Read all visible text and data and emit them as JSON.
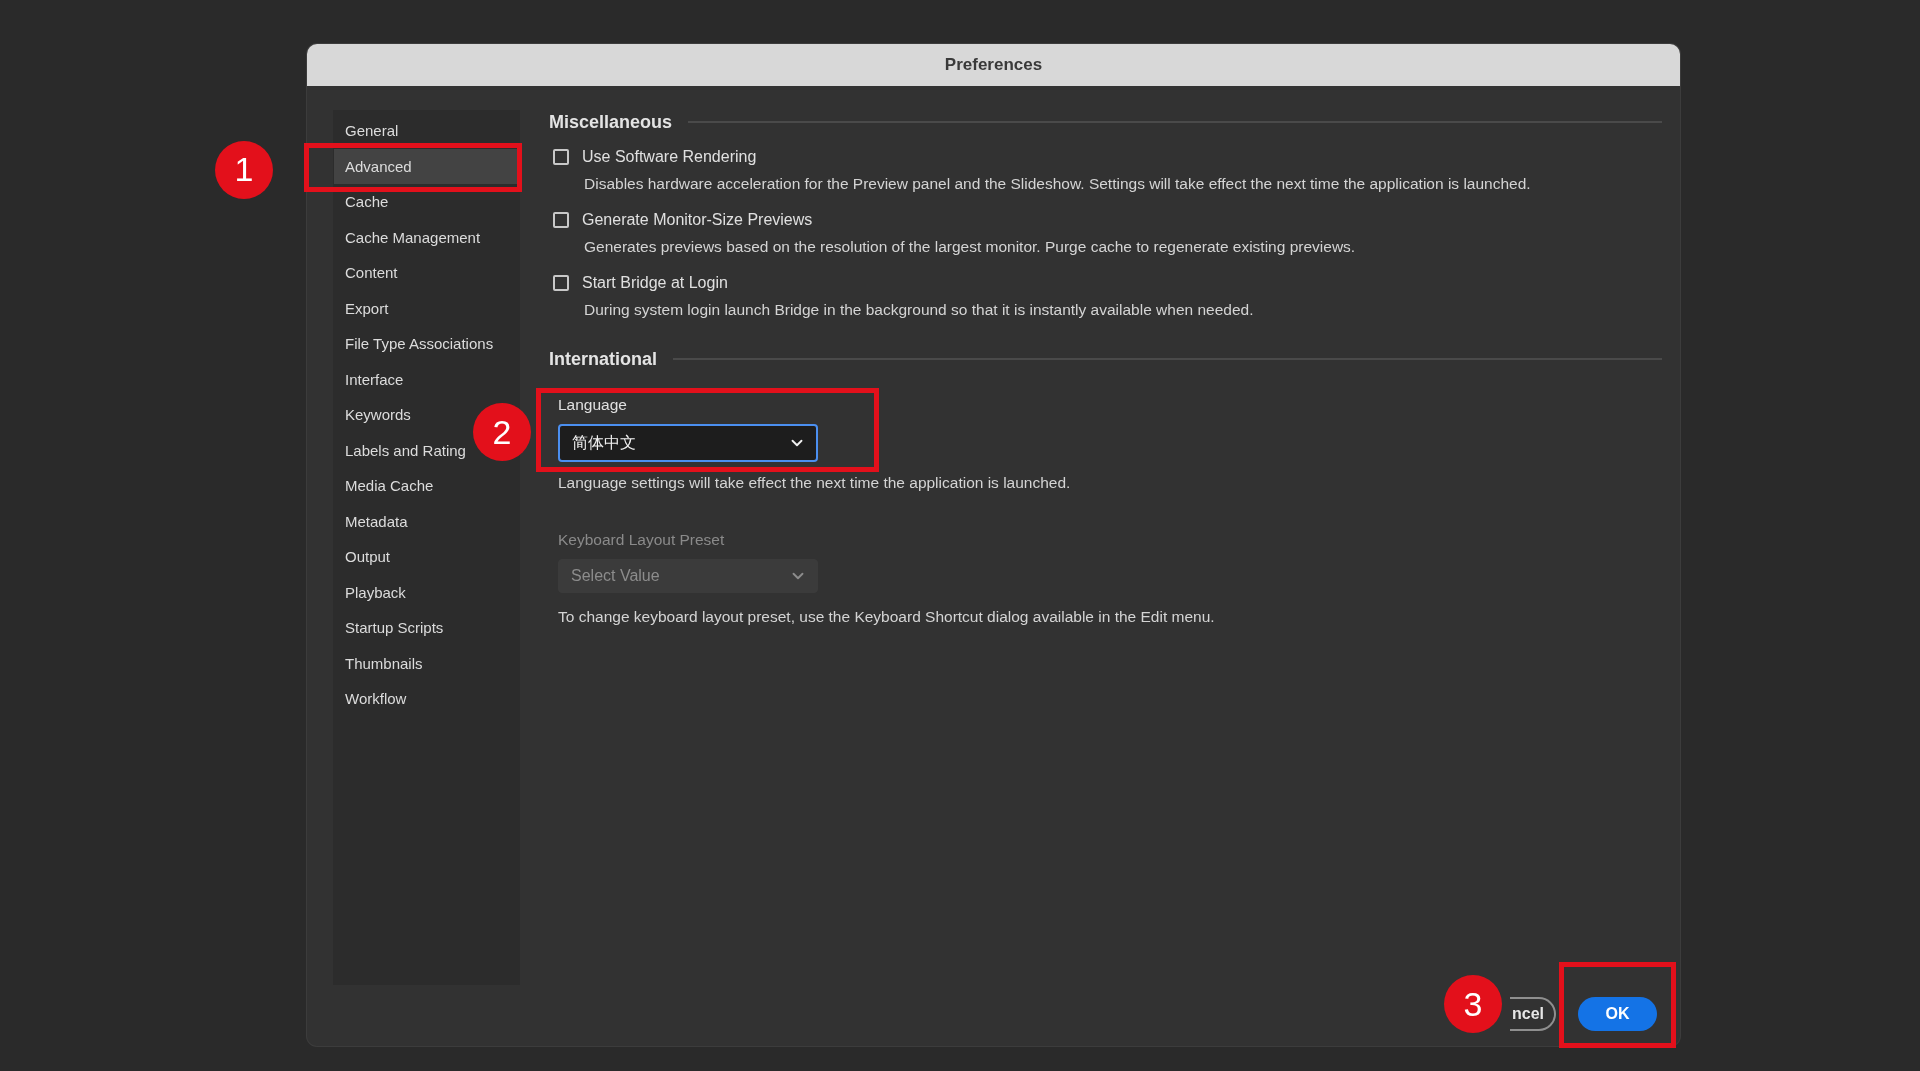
{
  "window": {
    "title": "Preferences"
  },
  "sidebar": {
    "items": [
      {
        "label": "General",
        "selected": false
      },
      {
        "label": "Advanced",
        "selected": true,
        "callout": "1"
      },
      {
        "label": "Cache",
        "selected": false
      },
      {
        "label": "Cache Management",
        "selected": false
      },
      {
        "label": "Content",
        "selected": false
      },
      {
        "label": "Export",
        "selected": false
      },
      {
        "label": "File Type Associations",
        "selected": false
      },
      {
        "label": "Interface",
        "selected": false
      },
      {
        "label": "Keywords",
        "selected": false
      },
      {
        "label": "Labels and Rating",
        "selected": false
      },
      {
        "label": "Media Cache",
        "selected": false
      },
      {
        "label": "Metadata",
        "selected": false
      },
      {
        "label": "Output",
        "selected": false
      },
      {
        "label": "Playback",
        "selected": false
      },
      {
        "label": "Startup Scripts",
        "selected": false
      },
      {
        "label": "Thumbnails",
        "selected": false
      },
      {
        "label": "Workflow",
        "selected": false
      }
    ]
  },
  "miscellaneous": {
    "title": "Miscellaneous",
    "options": [
      {
        "label": "Use Software Rendering",
        "checked": false,
        "description": "Disables hardware acceleration for the Preview panel and the Slideshow. Settings will take effect the next time the application is launched."
      },
      {
        "label": "Generate Monitor-Size Previews",
        "checked": false,
        "description": "Generates previews based on the resolution of the largest monitor.  Purge cache to regenerate existing previews."
      },
      {
        "label": "Start Bridge at Login",
        "checked": false,
        "description": "During system login launch Bridge in the background so that it is instantly available when needed."
      }
    ]
  },
  "international": {
    "title": "International",
    "language": {
      "label": "Language",
      "value": "简体中文",
      "focused": true,
      "disabled": false,
      "callout": "2",
      "note": "Language settings will take effect the next time the application is launched."
    },
    "keyboard_preset": {
      "label": "Keyboard Layout Preset",
      "value": "Select Value",
      "focused": false,
      "disabled": true,
      "note": "To change keyboard layout preset, use the Keyboard Shortcut dialog available in the Edit menu."
    }
  },
  "buttons": {
    "cancel": {
      "label": "ncel"
    },
    "ok": {
      "label": "OK",
      "callout": "3"
    }
  }
}
